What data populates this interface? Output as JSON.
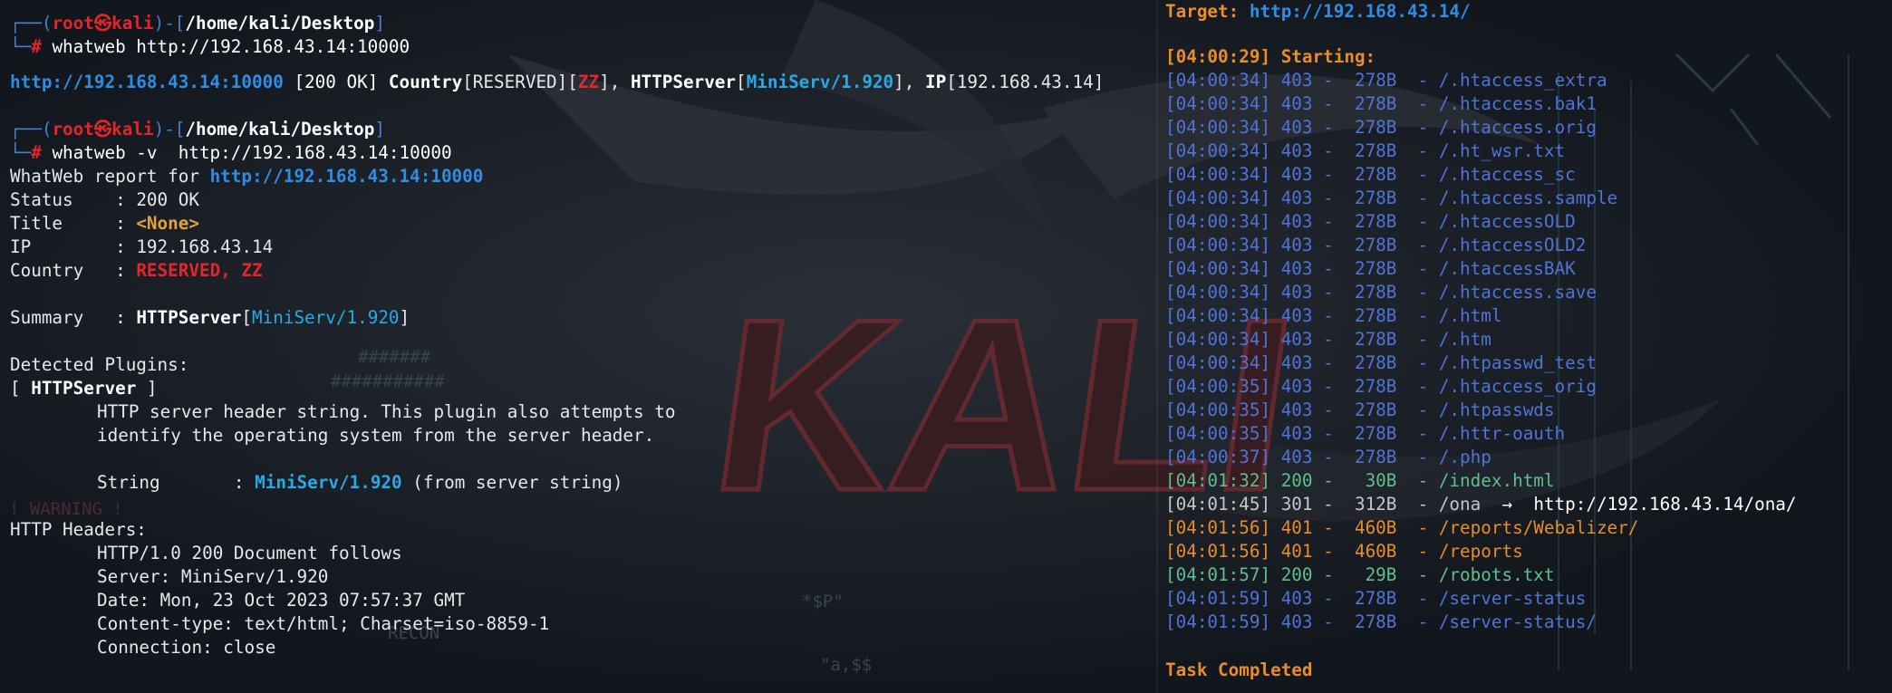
{
  "theme": {
    "background": "#12161d",
    "prompt_frame": "#4a7fcf",
    "prompt_user": "#e2262b",
    "url": "#2f8de4",
    "plugin": "#2aa9e6",
    "status_403": "#4f74d8",
    "status_200": "#5fbf8f",
    "status_301": "#c4c8cc",
    "status_401": "#e88d2a"
  },
  "left": {
    "prompt1": {
      "user": "root",
      "at": "㉿",
      "host": "kali",
      "path": "/home/kali/Desktop",
      "hash": "#",
      "command": "whatweb http://192.168.43.14:10000"
    },
    "result1": {
      "url": "http://192.168.43.14:10000",
      "status": "[200 OK]",
      "country_key": "Country",
      "country_val": "RESERVED",
      "zz": "ZZ",
      "http_key": "HTTPServer",
      "http_val": "MiniServ/1.920",
      "ip_key": "IP",
      "ip_val": "192.168.43.14"
    },
    "prompt2": {
      "user": "root",
      "at": "㉿",
      "host": "kali",
      "path": "/home/kali/Desktop",
      "hash": "#",
      "command": "whatweb -v  http://192.168.43.14:10000"
    },
    "report": {
      "header_prefix": "WhatWeb report for ",
      "header_url": "http://192.168.43.14:10000",
      "status_label": "Status    : ",
      "status_value": "200 OK",
      "title_label": "Title     : ",
      "title_value": "<None>",
      "ip_label": "IP        : ",
      "ip_value": "192.168.43.14",
      "country_label": "Country   : ",
      "country_value": "RESERVED, ZZ",
      "summary_label": "Summary   : ",
      "summary_key": "HTTPServer",
      "summary_value": "MiniServ/1.920",
      "plugins_heading": "Detected Plugins:",
      "plugin_name": "HTTPServer",
      "plugin_desc_1": "HTTP server header string. This plugin also attempts to",
      "plugin_desc_2": "identify the operating system from the server header.",
      "string_label": "String       : ",
      "string_value": "MiniServ/1.920",
      "string_suffix": " (from server string)",
      "headers_heading": "HTTP Headers:",
      "headers": [
        "HTTP/1.0 200 Document follows",
        "Server: MiniServ/1.920",
        "Date: Mon, 23 Oct 2023 07:57:37 GMT",
        "Content-type: text/html; Charset=iso-8859-1",
        "Connection: close"
      ]
    }
  },
  "right": {
    "target_label": "Target: ",
    "target_url": "http://192.168.43.14/",
    "starting": "[04:00:29] Starting:",
    "entries": [
      {
        "time": "[04:00:34]",
        "code": "403",
        "size": "278B",
        "path": "/.htaccess_extra"
      },
      {
        "time": "[04:00:34]",
        "code": "403",
        "size": "278B",
        "path": "/.htaccess.bak1"
      },
      {
        "time": "[04:00:34]",
        "code": "403",
        "size": "278B",
        "path": "/.htaccess.orig"
      },
      {
        "time": "[04:00:34]",
        "code": "403",
        "size": "278B",
        "path": "/.ht_wsr.txt"
      },
      {
        "time": "[04:00:34]",
        "code": "403",
        "size": "278B",
        "path": "/.htaccess_sc"
      },
      {
        "time": "[04:00:34]",
        "code": "403",
        "size": "278B",
        "path": "/.htaccess.sample"
      },
      {
        "time": "[04:00:34]",
        "code": "403",
        "size": "278B",
        "path": "/.htaccessOLD"
      },
      {
        "time": "[04:00:34]",
        "code": "403",
        "size": "278B",
        "path": "/.htaccessOLD2"
      },
      {
        "time": "[04:00:34]",
        "code": "403",
        "size": "278B",
        "path": "/.htaccessBAK"
      },
      {
        "time": "[04:00:34]",
        "code": "403",
        "size": "278B",
        "path": "/.htaccess.save"
      },
      {
        "time": "[04:00:34]",
        "code": "403",
        "size": "278B",
        "path": "/.html"
      },
      {
        "time": "[04:00:34]",
        "code": "403",
        "size": "278B",
        "path": "/.htm"
      },
      {
        "time": "[04:00:34]",
        "code": "403",
        "size": "278B",
        "path": "/.htpasswd_test"
      },
      {
        "time": "[04:00:35]",
        "code": "403",
        "size": "278B",
        "path": "/.htaccess_orig"
      },
      {
        "time": "[04:00:35]",
        "code": "403",
        "size": "278B",
        "path": "/.htpasswds"
      },
      {
        "time": "[04:00:35]",
        "code": "403",
        "size": "278B",
        "path": "/.httr-oauth"
      },
      {
        "time": "[04:00:37]",
        "code": "403",
        "size": "278B",
        "path": "/.php"
      },
      {
        "time": "[04:01:32]",
        "code": "200",
        "size": "30B",
        "path": "/index.html"
      },
      {
        "time": "[04:01:45]",
        "code": "301",
        "size": "312B",
        "path": "/ona",
        "redirect": "http://192.168.43.14/ona/"
      },
      {
        "time": "[04:01:56]",
        "code": "401",
        "size": "460B",
        "path": "/reports/Webalizer/"
      },
      {
        "time": "[04:01:56]",
        "code": "401",
        "size": "460B",
        "path": "/reports"
      },
      {
        "time": "[04:01:57]",
        "code": "200",
        "size": "29B",
        "path": "/robots.txt"
      },
      {
        "time": "[04:01:59]",
        "code": "403",
        "size": "278B",
        "path": "/server-status"
      },
      {
        "time": "[04:01:59]",
        "code": "403",
        "size": "278B",
        "path": "/server-status/"
      }
    ],
    "arrow": "→",
    "completed": "Task Completed"
  },
  "wallpaper": {
    "logo_text": "KALI",
    "art_marks": [
      "#######",
      "###########",
      "! WARNING !",
      "RECON",
      "*$P\"",
      "\"a,$$"
    ]
  }
}
